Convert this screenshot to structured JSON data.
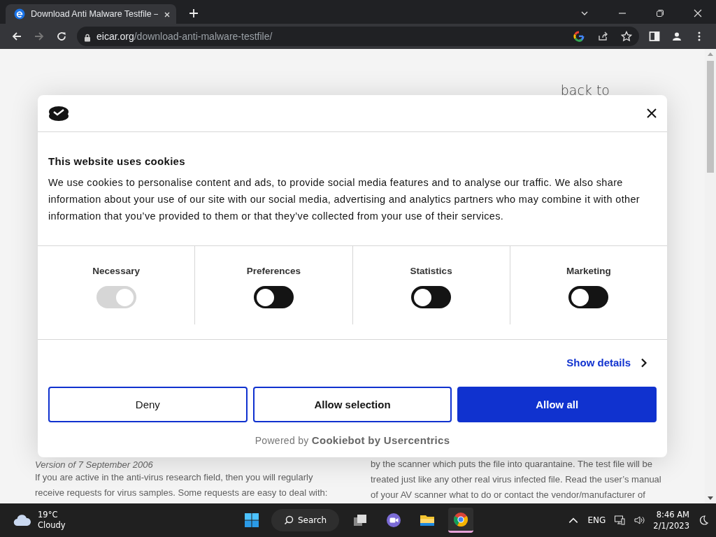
{
  "browser": {
    "tab": {
      "title": "Download Anti Malware Testfile –",
      "selected": true
    },
    "url_host": "eicar.org",
    "url_path": "/download-anti-malware-testfile/"
  },
  "page": {
    "back_link": "back to",
    "left": {
      "version": "Version of 7 September 2006",
      "paragraph": "If you are active in the anti-virus research field, then you will regularly receive requests for virus samples. Some requests are easy to deal with:"
    },
    "right": {
      "paragraph": "by the scanner which puts the file into quarantaine. The test file will be treated just like any other real virus infected file. Read the user’s manual of your AV scanner what to do or contact the vendor/manufacturer of"
    }
  },
  "cookie_dialog": {
    "title": "This website uses cookies",
    "text": "We use cookies to personalise content and ads, to provide social media features and to analyse our traffic. We also share information about your use of our site with our social media, advertising and analytics partners who may combine it with other information that you’ve provided to them or that they’ve collected from your use of their services.",
    "categories": [
      {
        "label": "Necessary",
        "on": true,
        "disabled": true
      },
      {
        "label": "Preferences",
        "on": false,
        "disabled": false
      },
      {
        "label": "Statistics",
        "on": false,
        "disabled": false
      },
      {
        "label": "Marketing",
        "on": false,
        "disabled": false
      }
    ],
    "show_details": "Show details",
    "buttons": [
      {
        "label": "Deny",
        "kind": "outline"
      },
      {
        "label": "Allow selection",
        "kind": "outline"
      },
      {
        "label": "Allow all",
        "kind": "primary"
      }
    ],
    "powered_by": "Powered by",
    "brand": "Cookiebot by Usercentrics"
  },
  "taskbar": {
    "weather": {
      "temp": "19°C",
      "condition": "Cloudy"
    },
    "search": "Search",
    "apps": [
      {
        "kind": "taskview",
        "selected": false
      },
      {
        "kind": "meet",
        "selected": false
      },
      {
        "kind": "folder",
        "selected": false
      },
      {
        "kind": "chrome",
        "selected": true
      }
    ],
    "language": "ENG",
    "time": "8:46 AM",
    "date": "2/1/2023"
  }
}
